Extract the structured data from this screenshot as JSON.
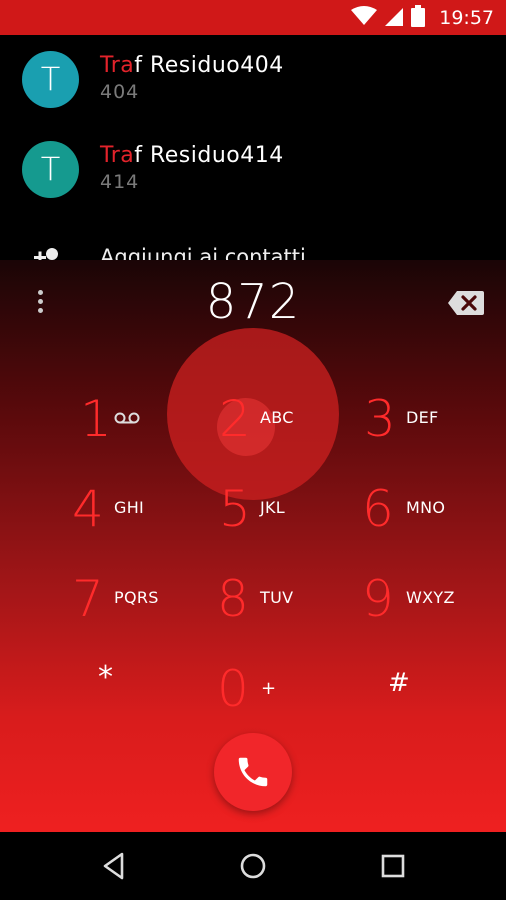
{
  "status_bar": {
    "time": "19:57",
    "icons": [
      "wifi-icon",
      "signal-icon",
      "battery-icon"
    ],
    "color": "#d01818"
  },
  "contacts": [
    {
      "avatar_letter": "T",
      "name_highlight": "Tra",
      "name_rest": "f Residuo404",
      "number": "404",
      "avatar_color": "#1a9fb0"
    },
    {
      "avatar_letter": "T",
      "name_highlight": "Tra",
      "name_rest": "f Residuo414",
      "number": "414",
      "avatar_color": "#159a8f"
    }
  ],
  "add_contact": {
    "label": "Aggiungi ai contatti",
    "icon": "add-person-icon"
  },
  "dialer": {
    "number": "872",
    "keys": [
      {
        "digit": "1",
        "letters": "",
        "icon": "voicemail-icon"
      },
      {
        "digit": "2",
        "letters": "ABC"
      },
      {
        "digit": "3",
        "letters": "DEF"
      },
      {
        "digit": "4",
        "letters": "GHI"
      },
      {
        "digit": "5",
        "letters": "JKL"
      },
      {
        "digit": "6",
        "letters": "MNO"
      },
      {
        "digit": "7",
        "letters": "PQRS"
      },
      {
        "digit": "8",
        "letters": "TUV"
      },
      {
        "digit": "9",
        "letters": "WXYZ"
      },
      {
        "digit": "*",
        "letters": ""
      },
      {
        "digit": "0",
        "letters": "+"
      },
      {
        "digit": "#",
        "letters": ""
      }
    ],
    "accent_color": "#ff2b2b",
    "call_icon": "phone-icon"
  },
  "nav": {
    "icons": [
      "back-icon",
      "home-icon",
      "recents-icon"
    ]
  }
}
